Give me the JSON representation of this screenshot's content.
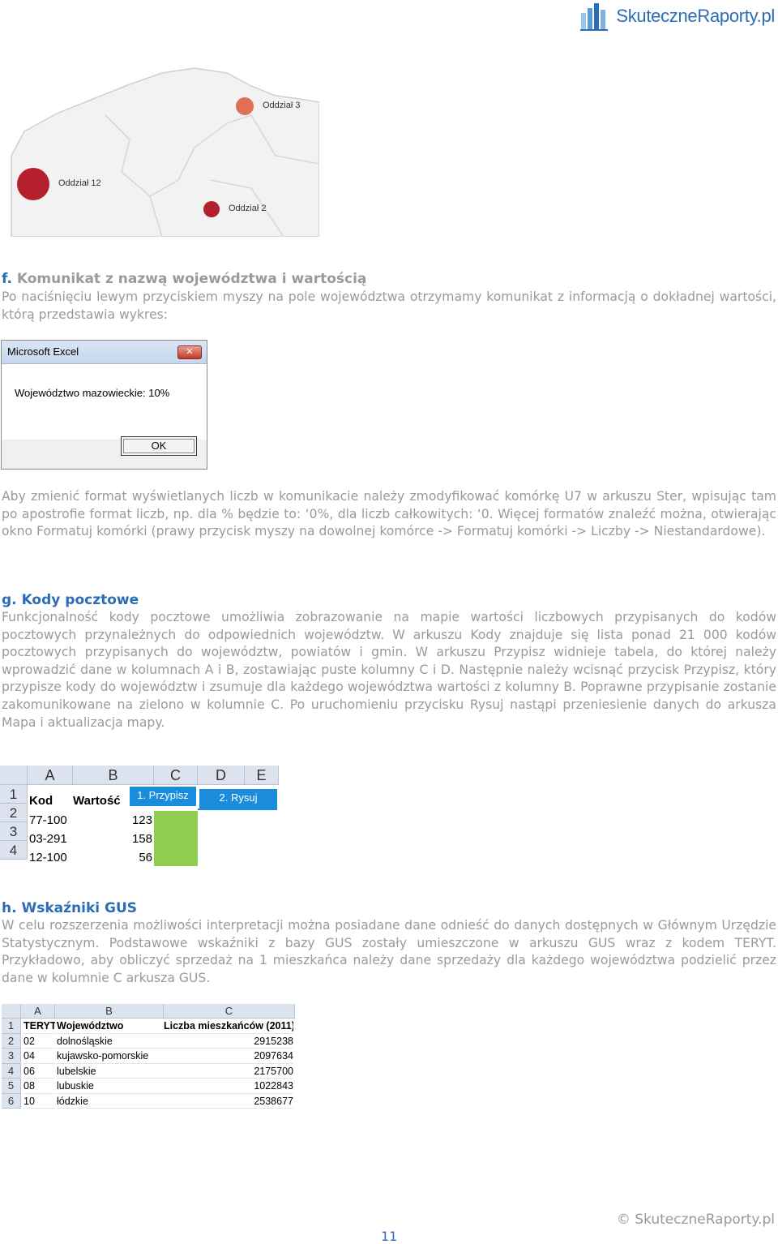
{
  "logo": {
    "text": "SkuteczneRaporty.pl"
  },
  "map": {
    "labels": [
      "Oddział 3",
      "Oddział 12",
      "Oddział 2"
    ]
  },
  "sections": {
    "f": {
      "letter": "f.",
      "title": "Komunikat z nazwą województwa i wartością",
      "intro": "Po naciśnięciu lewym przyciskiem myszy na pole województwa otrzymamy komunikat z informacją o dokładnej wartości, którą przedstawia wykres:",
      "after": "Aby zmienić format wyświetlanych liczb w komunikacie należy zmodyfikować komórkę U7 w arkuszu Ster, wpisując tam po apostrofie format liczb, np. dla % będzie to: ‘0%, dla liczb całkowitych: ‘0. Więcej formatów znaleźć można, otwierając okno Formatuj komórki (prawy przycisk myszy na dowolnej komórce -> Formatuj komórki -> Liczby -> Niestandardowe)."
    },
    "g": {
      "letter": "g.",
      "title": "Kody pocztowe",
      "body": "Funkcjonalność kody pocztowe umożliwia zobrazowanie na mapie wartości liczbowych przypisanych do kodów pocztowych przynależnych do odpowiednich województw. W arkuszu Kody znajduje się lista ponad 21 000 kodów pocztowych przypisanych do województw, powiatów i gmin. W arkuszu Przypisz widnieje tabela, do której należy wprowadzić dane w kolumnach A i B, zostawiając puste kolumny C i D. Następnie należy wcisnąć przycisk Przypisz, który przypisze kody do województw i zsumuje dla każdego województwa wartości z kolumny B. Poprawne przypisanie zostanie zakomunikowane na zielono w kolumnie C. Po uruchomieniu przycisku Rysuj nastąpi przeniesienie danych do arkusza Mapa i aktualizacja mapy."
    },
    "h": {
      "letter": "h.",
      "title": "Wskaźniki GUS",
      "body": "W celu rozszerzenia możliwości interpretacji można posiadane dane odnieść do danych dostępnych w Głównym Urzędzie Statystycznym. Podstawowe wskaźniki z bazy GUS zostały umieszczone w arkuszu GUS wraz z kodem TERYT. Przykładowo, aby obliczyć sprzedaż na 1 mieszkańca należy dane sprzedaży dla każdego województwa podzielić przez dane w kolumnie C arkusza GUS."
    }
  },
  "dialog": {
    "title": "Microsoft Excel",
    "close": "✕",
    "message": "Województwo mazowieckie: 10%",
    "ok": "OK"
  },
  "sheet1": {
    "columns": [
      "A",
      "B",
      "C",
      "D",
      "E"
    ],
    "rows": [
      "1",
      "2",
      "3",
      "4"
    ],
    "header": {
      "kod": "Kod",
      "wartosc": "Wartość"
    },
    "buttons": {
      "przypisz": "1. Przypisz",
      "rysuj": "2. Rysuj"
    },
    "data": [
      {
        "kod": "77-100",
        "wartosc": "123"
      },
      {
        "kod": "03-291",
        "wartosc": "158"
      },
      {
        "kod": "12-100",
        "wartosc": "56"
      }
    ]
  },
  "sheet2": {
    "columns": [
      "A",
      "B",
      "C"
    ],
    "rows": [
      "1",
      "2",
      "3",
      "4",
      "5",
      "6"
    ],
    "header": {
      "a": "TERYT",
      "b": "Województwo",
      "c": "Liczba mieszkańców (2011)"
    },
    "data": [
      {
        "a": "02",
        "b": "dolnośląskie",
        "c": "2915238"
      },
      {
        "a": "04",
        "b": "kujawsko-pomorskie",
        "c": "2097634"
      },
      {
        "a": "06",
        "b": "lubelskie",
        "c": "2175700"
      },
      {
        "a": "08",
        "b": "lubuskie",
        "c": "1022843"
      },
      {
        "a": "10",
        "b": "łódzkie",
        "c": "2538677"
      }
    ]
  },
  "footer": {
    "page": "11",
    "copyright": "© SkuteczneRaporty.pl"
  },
  "colors": {
    "accent": "#2a6db5",
    "bubble_red": "#b5202e",
    "bubble_orange": "#e07055",
    "green": "#8fce4e",
    "button_blue": "#1a8cdc"
  }
}
